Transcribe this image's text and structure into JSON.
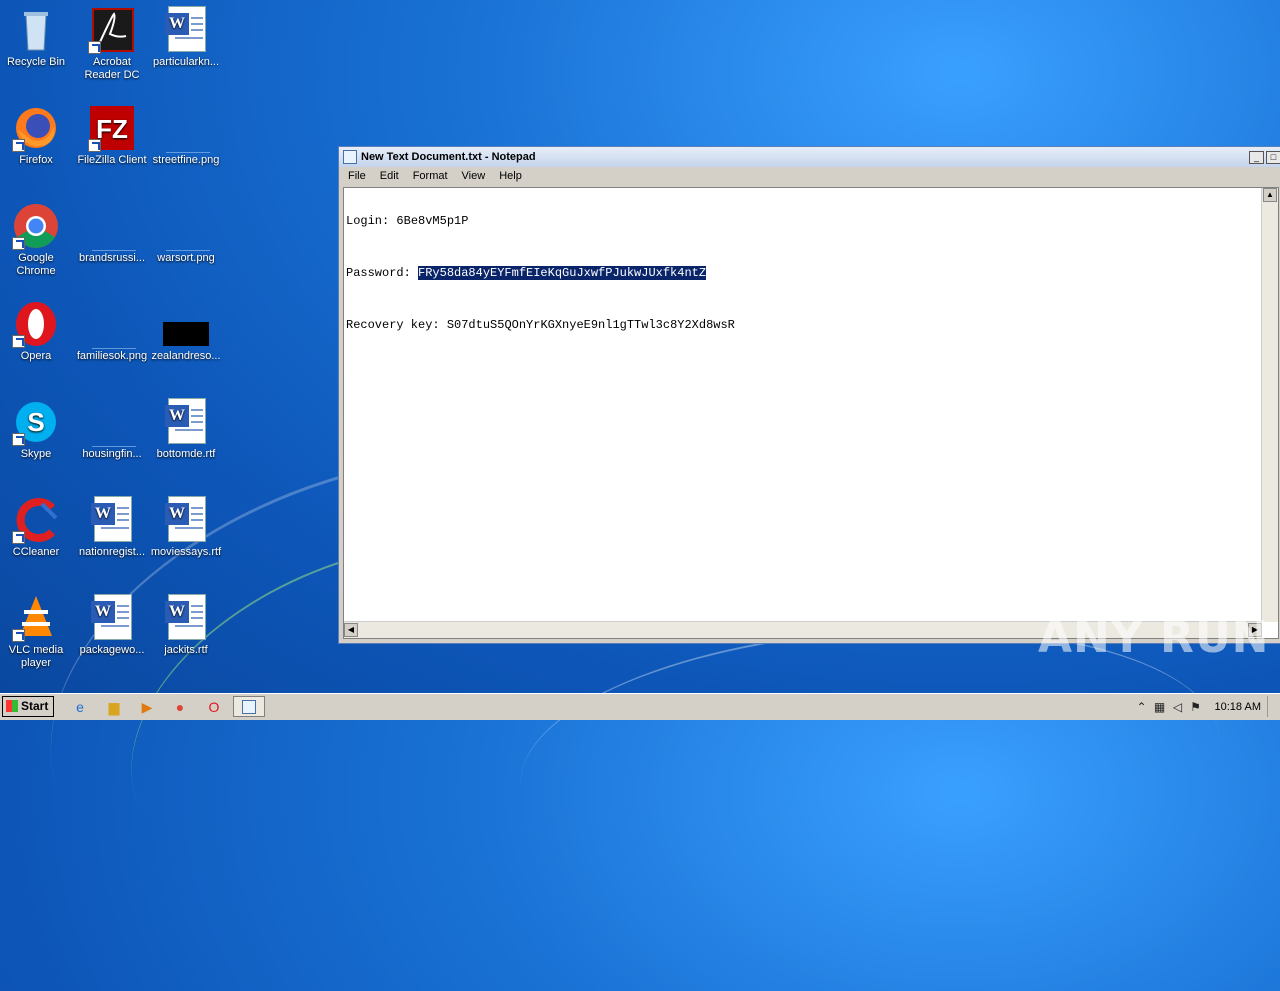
{
  "desktop": {
    "icons": [
      {
        "label": "Recycle Bin"
      },
      {
        "label": "Acrobat Reader DC"
      },
      {
        "label": "particularkn..."
      },
      {
        "label": "Firefox"
      },
      {
        "label": "FileZilla Client"
      },
      {
        "label": "streetfine.png"
      },
      {
        "label": "Google Chrome"
      },
      {
        "label": "brandsrussi..."
      },
      {
        "label": "warsort.png"
      },
      {
        "label": "Opera"
      },
      {
        "label": "familiesok.png"
      },
      {
        "label": "zealandreso..."
      },
      {
        "label": "Skype"
      },
      {
        "label": "housingfin..."
      },
      {
        "label": "bottomde.rtf"
      },
      {
        "label": "CCleaner"
      },
      {
        "label": "nationregist..."
      },
      {
        "label": "moviessays.rtf"
      },
      {
        "label": "VLC media player"
      },
      {
        "label": "packagewo..."
      },
      {
        "label": "jackits.rtf"
      }
    ]
  },
  "notepad": {
    "title": "New Text Document.txt - Notepad",
    "menu": [
      "File",
      "Edit",
      "Format",
      "View",
      "Help"
    ],
    "lines": {
      "login_label": "Login: ",
      "login_value": "6Be8vM5p1P",
      "password_label": "Password: ",
      "password_value": "FRy58da84yEYFmfEIeKqGuJxwfPJukwJUxfk4ntZ",
      "recovery_label": "Recovery key: ",
      "recovery_value": "S07dtuS5QOnYrKGXnyeE9nl1gTTwl3c8Y2Xd8wsR"
    }
  },
  "watermark": "ANY RUN",
  "taskbar": {
    "start_label": "Start",
    "clock": "10:18 AM"
  }
}
